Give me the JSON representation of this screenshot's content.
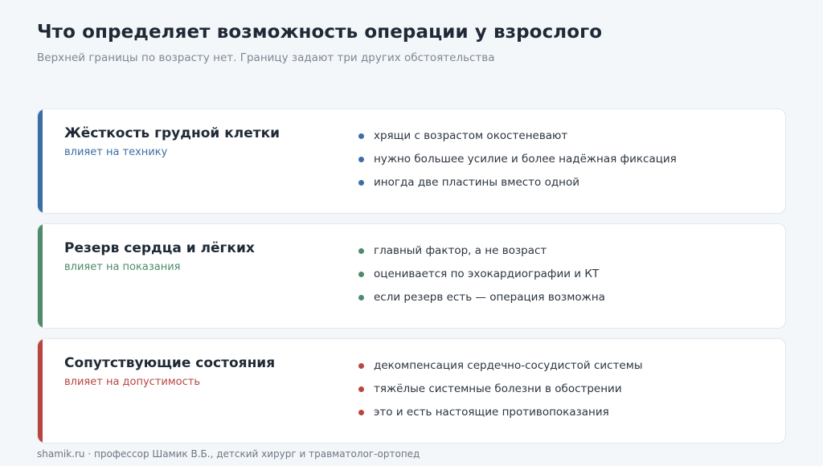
{
  "header": {
    "title": "Что определяет возможность операции у взрослого",
    "subtitle": "Верхней границы по возрасту нет. Границу задают три других обстоятельства"
  },
  "cards": [
    {
      "heading": "Жёсткость грудной клетки",
      "impact": "влияет на технику",
      "color": "#3a6ea5",
      "points": [
        "хрящи с возрастом окостеневают",
        "нужно большее усилие и более надёжная фиксация",
        "иногда две пластины вместо одной"
      ]
    },
    {
      "heading": "Резерв сердца и лёгких",
      "impact": "влияет на показания",
      "color": "#4f8a6b",
      "points": [
        "главный фактор, а не возраст",
        "оценивается по эхокардиографии и КТ",
        "если резерв есть — операция возможна"
      ]
    },
    {
      "heading": "Сопутствующие состояния",
      "impact": "влияет на допустимость",
      "color": "#b8463f",
      "points": [
        "декомпенсация сердечно-сосудистой системы",
        "тяжёлые системные болезни в обострении",
        "это и есть настоящие противопоказания"
      ]
    }
  ],
  "footer": {
    "text": "shamik.ru · профессор Шамик В.Б., детский хирург и травматолог-ортопед"
  }
}
